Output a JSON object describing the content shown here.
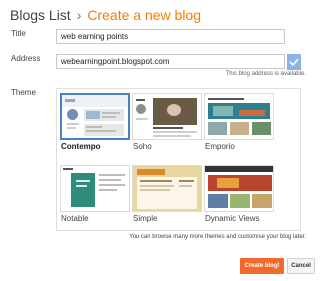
{
  "breadcrumb": {
    "root": "Blogs List",
    "separator": "›",
    "current": "Create a new blog"
  },
  "form": {
    "title_label": "Title",
    "title_value": "web earning points",
    "address_label": "Address",
    "address_value": "webearningpoint.blogspot.com",
    "address_hint": "This blog address is available.",
    "theme_label": "Theme"
  },
  "themes": [
    {
      "name": "Contempo",
      "selected": true
    },
    {
      "name": "Soho",
      "selected": false
    },
    {
      "name": "Emporio",
      "selected": false
    },
    {
      "name": "Notable",
      "selected": false
    },
    {
      "name": "Simple",
      "selected": false
    },
    {
      "name": "Dynamic Views",
      "selected": false
    }
  ],
  "themes_note": "You can browse many more themes and customise your blog later.",
  "actions": {
    "create": "Create blog!",
    "cancel": "Cancel"
  },
  "colors": {
    "accent": "#f57d00",
    "create_button": "#f06a2c",
    "selected_border": "#4a7fc1",
    "check_button": "#8ab4e8"
  },
  "icons": {
    "address_check": "check-icon"
  }
}
